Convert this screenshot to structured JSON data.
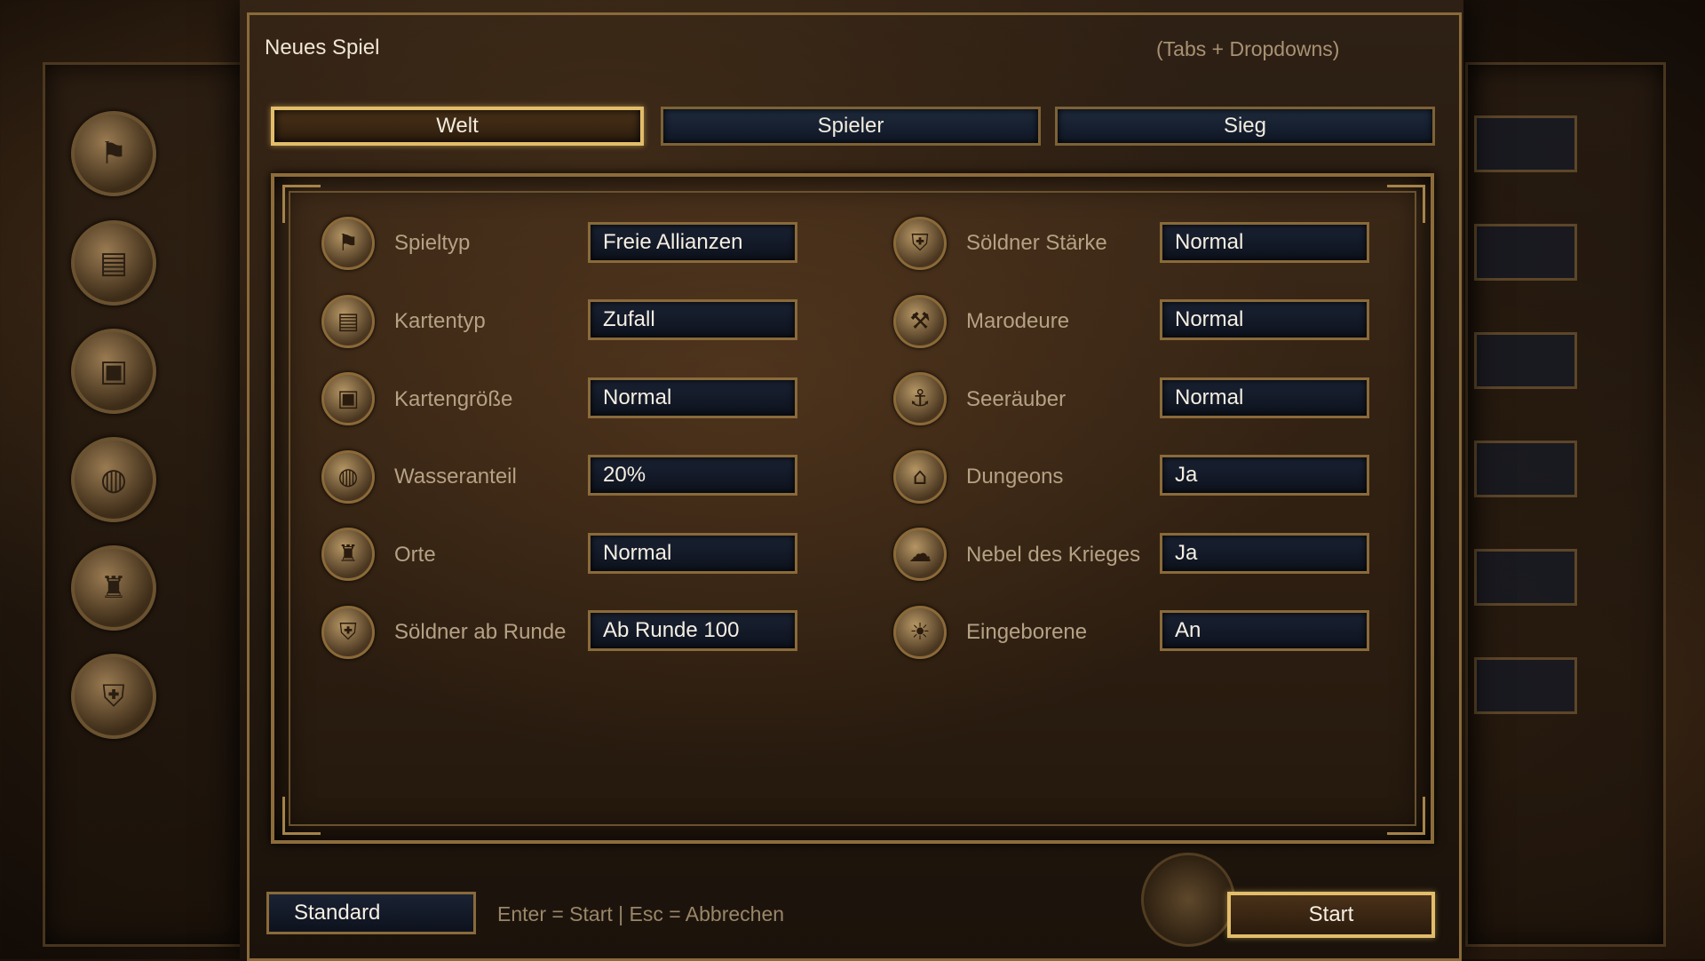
{
  "dialog": {
    "title": "Neues Spiel",
    "hint": "(Tabs + Dropdowns)"
  },
  "tabs": [
    {
      "label": "Welt",
      "active": true
    },
    {
      "label": "Spieler",
      "active": false
    },
    {
      "label": "Sieg",
      "active": false
    }
  ],
  "left_column": [
    {
      "label": "Spieltyp",
      "value": "Freie Allianzen",
      "icon": "banner-icon"
    },
    {
      "label": "Kartentyp",
      "value": "Zufall",
      "icon": "map-icon"
    },
    {
      "label": "Kartengröße",
      "value": "Normal",
      "icon": "map-frame-icon"
    },
    {
      "label": "Wasseranteil",
      "value": "20%",
      "icon": "island-icon"
    },
    {
      "label": "Orte",
      "value": "Normal",
      "icon": "places-icon"
    },
    {
      "label": "Söldner ab Runde",
      "value": "Ab Runde 100",
      "icon": "helmet-icon"
    }
  ],
  "right_column": [
    {
      "label": "Söldner Stärke",
      "value": "Normal",
      "icon": "helmet-icon"
    },
    {
      "label": "Marodeure",
      "value": "Normal",
      "icon": "axe-icon"
    },
    {
      "label": "Seeräuber",
      "value": "Normal",
      "icon": "anchor-icon"
    },
    {
      "label": "Dungeons",
      "value": "Ja",
      "icon": "dungeon-gate-icon"
    },
    {
      "label": "Nebel des Krieges",
      "value": "Ja",
      "icon": "fog-icon"
    },
    {
      "label": "Eingeborene",
      "value": "An",
      "icon": "natives-icon"
    }
  ],
  "footer": {
    "standard_label": "Standard",
    "hint": "Enter = Start | Esc = Abbrechen",
    "start_label": "Start"
  },
  "colors": {
    "accent_gold": "#e2bd6a",
    "frame_bronze": "#8a6a3a",
    "field_navy": "#0d121d"
  }
}
